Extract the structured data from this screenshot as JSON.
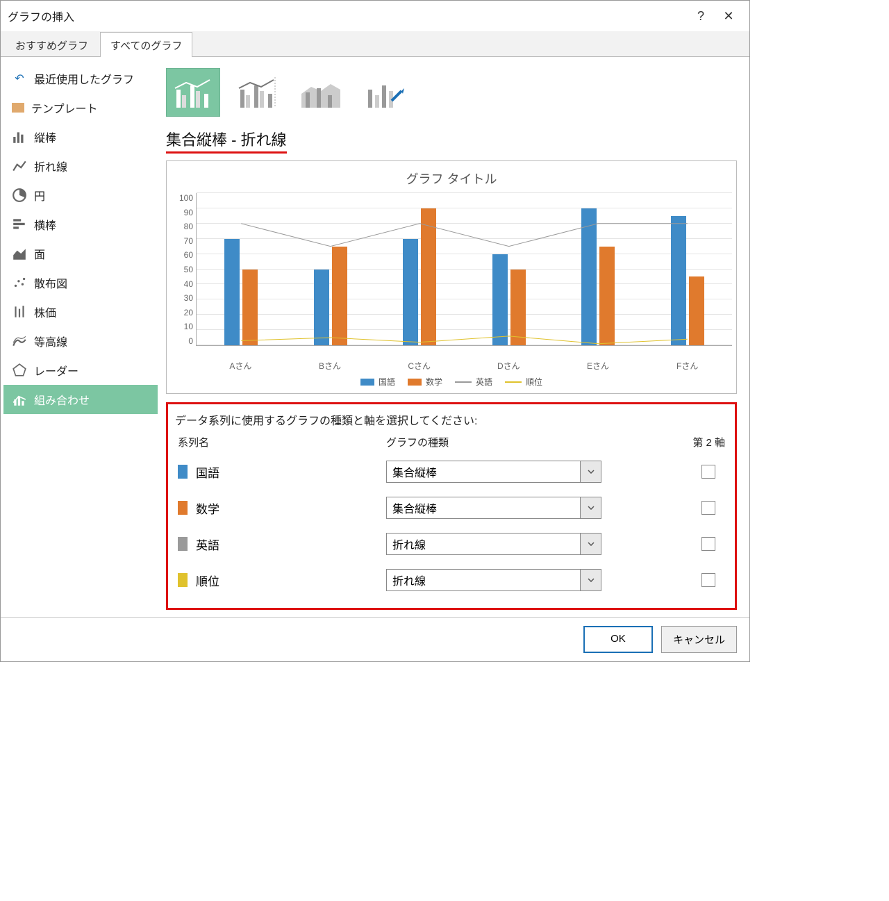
{
  "dialog_title": "グラフの挿入",
  "tabs": {
    "recommended": "おすすめグラフ",
    "all": "すべてのグラフ"
  },
  "sidebar": {
    "items": [
      {
        "label": "最近使用したグラフ"
      },
      {
        "label": "テンプレート"
      },
      {
        "label": "縦棒"
      },
      {
        "label": "折れ線"
      },
      {
        "label": "円"
      },
      {
        "label": "横棒"
      },
      {
        "label": "面"
      },
      {
        "label": "散布図"
      },
      {
        "label": "株価"
      },
      {
        "label": "等高線"
      },
      {
        "label": "レーダー"
      },
      {
        "label": "組み合わせ"
      }
    ]
  },
  "subtype_label": "集合縦棒 - 折れ線",
  "preview": {
    "title": "グラフ タイトル"
  },
  "chart_data": {
    "type": "bar+line",
    "categories": [
      "Aさん",
      "Bさん",
      "Cさん",
      "Dさん",
      "Eさん",
      "Fさん"
    ],
    "yticks": [
      0,
      10,
      20,
      30,
      40,
      50,
      60,
      70,
      80,
      90,
      100
    ],
    "ylim": [
      0,
      100
    ],
    "series": [
      {
        "name": "国語",
        "render": "bar",
        "color": "#3f8bc7",
        "values": [
          70,
          50,
          70,
          60,
          90,
          85
        ]
      },
      {
        "name": "数学",
        "render": "bar",
        "color": "#e07a2d",
        "values": [
          50,
          65,
          90,
          50,
          65,
          45
        ]
      },
      {
        "name": "英語",
        "render": "line",
        "color": "#9a9a9a",
        "values": [
          80,
          65,
          80,
          65,
          80,
          80
        ]
      },
      {
        "name": "順位",
        "render": "line",
        "color": "#e0c22d",
        "values": [
          3,
          5,
          2,
          6,
          1,
          4
        ]
      }
    ]
  },
  "series_panel": {
    "instruction": "データ系列に使用するグラフの種類と軸を選択してください:",
    "col_name": "系列名",
    "col_type": "グラフの種類",
    "col_axis": "第 2 軸",
    "rows": [
      {
        "name": "国語",
        "color": "#3f8bc7",
        "type": "集合縦棒",
        "axis2": false
      },
      {
        "name": "数学",
        "color": "#e07a2d",
        "type": "集合縦棒",
        "axis2": false
      },
      {
        "name": "英語",
        "color": "#9a9a9a",
        "type": "折れ線",
        "axis2": false
      },
      {
        "name": "順位",
        "color": "#e0c22d",
        "type": "折れ線",
        "axis2": false
      }
    ]
  },
  "footer": {
    "ok": "OK",
    "cancel": "キャンセル"
  }
}
